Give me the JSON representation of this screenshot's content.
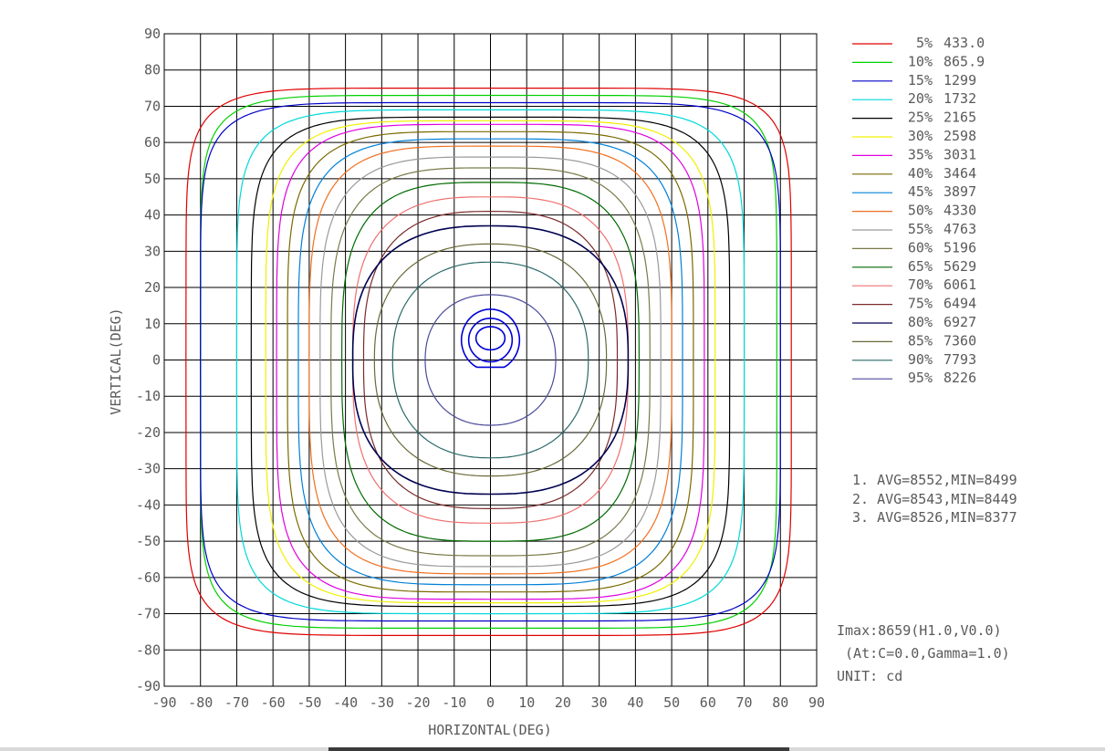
{
  "chart_data": {
    "type": "contour",
    "title": "",
    "xlabel": "HORIZONTAL(DEG)",
    "ylabel": "VERTICAL(DEG)",
    "xlim": [
      -90,
      90
    ],
    "ylim": [
      -90,
      90
    ],
    "x_ticks": [
      -90,
      -80,
      -70,
      -60,
      -50,
      -40,
      -30,
      -20,
      -10,
      0,
      10,
      20,
      30,
      40,
      50,
      60,
      70,
      80,
      90
    ],
    "y_ticks": [
      90,
      80,
      70,
      60,
      50,
      40,
      30,
      20,
      10,
      0,
      -10,
      -20,
      -30,
      -40,
      -50,
      -60,
      -70,
      -80,
      -90
    ],
    "grid": true,
    "legend_position": "right",
    "series": [
      {
        "percent": "5%",
        "value": "433.0",
        "color": "#e00000",
        "extent": {
          "left": 84,
          "right": 83,
          "top": 75,
          "bottom": 76
        },
        "shape": 7.5
      },
      {
        "percent": "10%",
        "value": "865.9",
        "color": "#00d000",
        "extent": {
          "left": 80,
          "right": 79,
          "top": 73,
          "bottom": 74
        },
        "shape": 7.5
      },
      {
        "percent": "15%",
        "value": "1299",
        "color": "#0000c8",
        "extent": {
          "left": 80,
          "right": 80,
          "top": 71,
          "bottom": 72
        },
        "shape": 7
      },
      {
        "percent": "20%",
        "value": "1732",
        "color": "#00d8d8",
        "extent": {
          "left": 70,
          "right": 70,
          "top": 69,
          "bottom": 70
        },
        "shape": 6
      },
      {
        "percent": "25%",
        "value": "2165",
        "color": "#000000",
        "extent": {
          "left": 66,
          "right": 66,
          "top": 67,
          "bottom": 68
        },
        "shape": 5.5
      },
      {
        "percent": "30%",
        "value": "2598",
        "color": "#f0f000",
        "extent": {
          "left": 62,
          "right": 62,
          "top": 66,
          "bottom": 67
        },
        "shape": 5
      },
      {
        "percent": "35%",
        "value": "3031",
        "color": "#e000e0",
        "extent": {
          "left": 59,
          "right": 59,
          "top": 65,
          "bottom": 66
        },
        "shape": 4.8
      },
      {
        "percent": "40%",
        "value": "3464",
        "color": "#7a6a00",
        "extent": {
          "left": 56,
          "right": 56,
          "top": 63,
          "bottom": 64
        },
        "shape": 4.5
      },
      {
        "percent": "45%",
        "value": "3897",
        "color": "#0080d8",
        "extent": {
          "left": 53,
          "right": 53,
          "top": 61,
          "bottom": 62
        },
        "shape": 4.2
      },
      {
        "percent": "50%",
        "value": "4330",
        "color": "#f07020",
        "extent": {
          "left": 50,
          "right": 50,
          "top": 59,
          "bottom": 59
        },
        "shape": 4
      },
      {
        "percent": "55%",
        "value": "4763",
        "color": "#9a9a9a",
        "extent": {
          "left": 47,
          "right": 47,
          "top": 56,
          "bottom": 57
        },
        "shape": 3.8
      },
      {
        "percent": "60%",
        "value": "5196",
        "color": "#7a7a4a",
        "extent": {
          "left": 44,
          "right": 44,
          "top": 53,
          "bottom": 54
        },
        "shape": 3.5
      },
      {
        "percent": "65%",
        "value": "5629",
        "color": "#006a00",
        "extent": {
          "left": 41,
          "right": 41,
          "top": 49,
          "bottom": 50
        },
        "shape": 3.3
      },
      {
        "percent": "70%",
        "value": "6061",
        "color": "#f07070",
        "extent": {
          "left": 38,
          "right": 38,
          "top": 45,
          "bottom": 45
        },
        "shape": 3
      },
      {
        "percent": "75%",
        "value": "6494",
        "color": "#7a2a2a",
        "extent": {
          "left": 35,
          "right": 35,
          "top": 41,
          "bottom": 41
        },
        "shape": 2.8
      },
      {
        "percent": "80%",
        "value": "6927",
        "color": "#000050",
        "extent": {
          "left": 38,
          "right": 38,
          "top": 37,
          "bottom": 37
        },
        "shape": 2.6
      },
      {
        "percent": "85%",
        "value": "7360",
        "color": "#6a6a3a",
        "extent": {
          "left": 32,
          "right": 32,
          "top": 32,
          "bottom": 32
        },
        "shape": 2.4
      },
      {
        "percent": "90%",
        "value": "7793",
        "color": "#2a6a6a",
        "extent": {
          "left": 27,
          "right": 27,
          "top": 27,
          "bottom": 27
        },
        "shape": 2.3
      },
      {
        "percent": "95%",
        "value": "8226",
        "color": "#4a4a9a",
        "extent": {
          "left": 18,
          "right": 18,
          "top": 18,
          "bottom": 18
        },
        "shape": 2.2
      }
    ],
    "center_contours": [
      {
        "color": "#0000d8",
        "cx": 0,
        "cy": 5.5,
        "rx": 8,
        "ry": 8.5,
        "flat_bottom": -2
      },
      {
        "color": "#0000d8",
        "cx": 0,
        "cy": 5.5,
        "rx": 6,
        "ry": 6
      },
      {
        "color": "#0000d8",
        "cx": 0,
        "cy": 6,
        "rx": 4,
        "ry": 3.2
      }
    ],
    "notes": [
      "1. AVG=8552,MIN=8499",
      "2. AVG=8543,MIN=8449",
      "3. AVG=8526,MIN=8377"
    ],
    "info": {
      "imax": "Imax:8659(H1.0,V0.0)",
      "at": " (At:C=0.0,Gamma=1.0)",
      "unit": "UNIT: cd"
    }
  }
}
